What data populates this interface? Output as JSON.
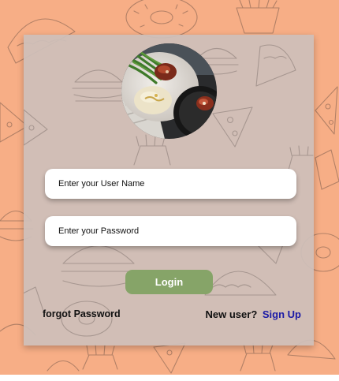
{
  "theme": {
    "background": "#f7ae86",
    "card": "#cdc0ba",
    "button": "#86a468",
    "link": "#1b1aa6"
  },
  "hero": {
    "icon": "food-plate-photo"
  },
  "form": {
    "username_placeholder": "Enter your User Name",
    "password_placeholder": "Enter your Password",
    "login_label": "Login"
  },
  "links": {
    "forgot_label": "forgot Password",
    "new_user_label": "New user?",
    "signup_label": "Sign Up"
  }
}
